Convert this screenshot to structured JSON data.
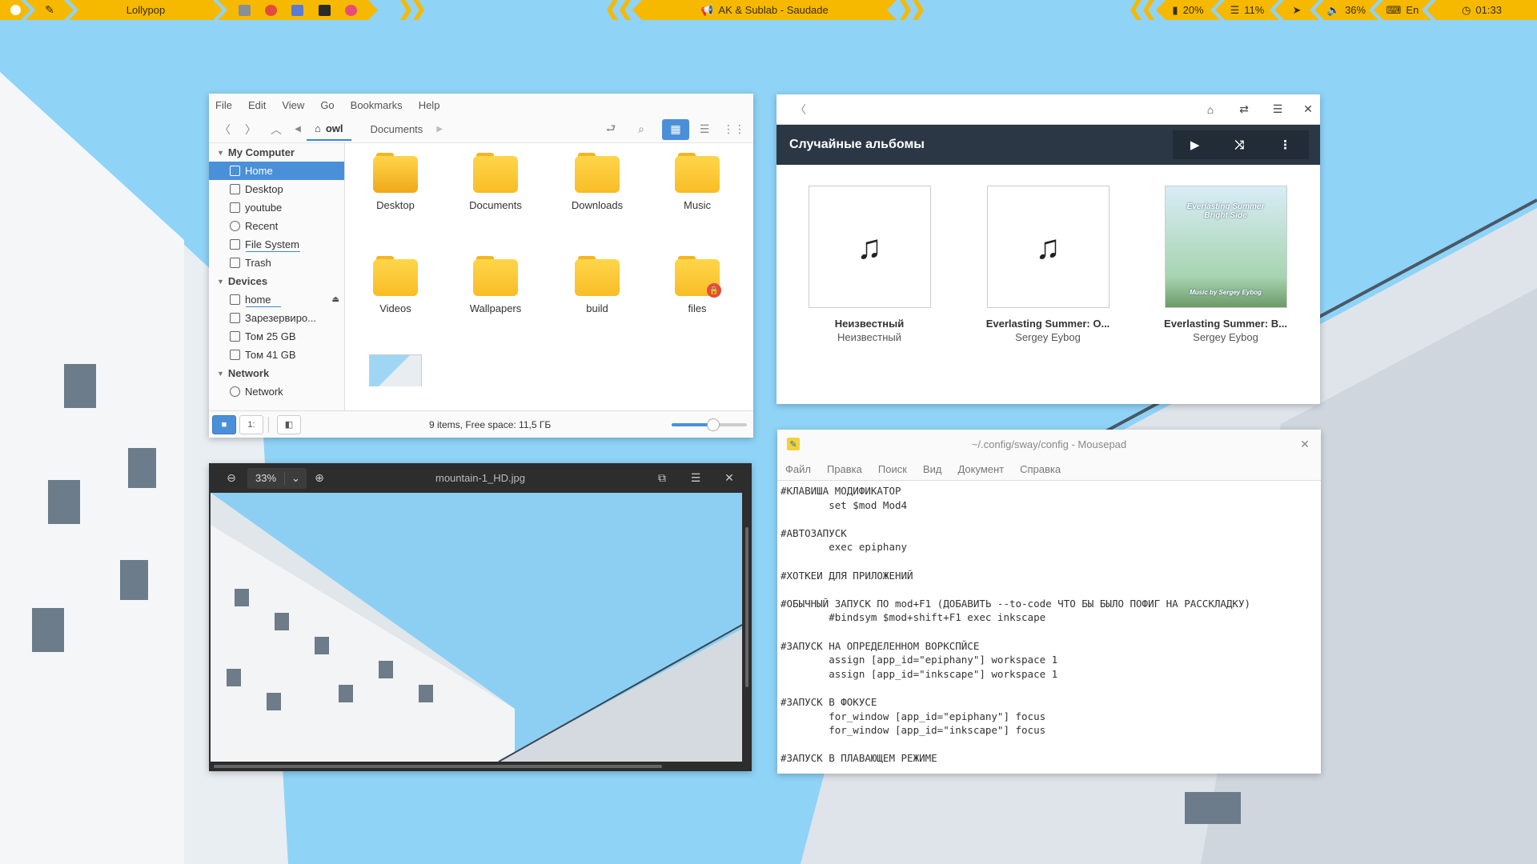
{
  "topbar": {
    "left_app": "Lollypop",
    "now_playing": "AK & Sublab - Saudade",
    "status": {
      "battery": "20%",
      "brightness": "11%",
      "volume": "36%",
      "layout": "En",
      "clock": "01:33"
    },
    "accent": "#f6b900"
  },
  "file_manager": {
    "menu": [
      "File",
      "Edit",
      "View",
      "Go",
      "Bookmarks",
      "Help"
    ],
    "breadcrumb": [
      "owl",
      "Documents"
    ],
    "sidebar": {
      "my_computer": "My Computer",
      "places": [
        {
          "label": "Home",
          "icon": "home-icon",
          "selected": true
        },
        {
          "label": "Desktop",
          "icon": "desktop-icon"
        },
        {
          "label": "youtube",
          "icon": "folder-icon"
        },
        {
          "label": "Recent",
          "icon": "clock-icon"
        },
        {
          "label": "File System",
          "icon": "drive-icon"
        },
        {
          "label": "Trash",
          "icon": "trash-icon"
        }
      ],
      "devices": "Devices",
      "device_items": [
        {
          "label": "home",
          "icon": "drive-icon"
        },
        {
          "label": "Зарезервиро...",
          "icon": "drive-icon"
        },
        {
          "label": "Том 25 GB",
          "icon": "drive-icon"
        },
        {
          "label": "Том 41 GB",
          "icon": "drive-icon"
        }
      ],
      "network": "Network",
      "network_items": [
        {
          "label": "Network",
          "icon": "globe-icon"
        }
      ]
    },
    "items": [
      "Desktop",
      "Documents",
      "Downloads",
      "Music",
      "Videos",
      "Wallpapers",
      "build",
      "files"
    ],
    "status": "9 items, Free space: 11,5 ГБ",
    "zoom_level": 0.55
  },
  "music": {
    "section_title": "Случайные альбомы",
    "albums": [
      {
        "title": "Неизвестный",
        "artist": "Неизвестный"
      },
      {
        "title": "Everlasting Summer: O...",
        "artist": "Sergey Eybog"
      },
      {
        "title": "Everlasting Summer: B...",
        "artist": "Sergey Eybog",
        "cover_line1": "Everlasting Summer",
        "cover_line2": "Bright Side",
        "cover_footer": "Music by Sergey Eybog"
      }
    ]
  },
  "image_viewer": {
    "zoom": "33%",
    "filename": "mountain-1_HD.jpg"
  },
  "editor": {
    "title": "~/.config/sway/config - Mousepad",
    "menu": [
      "Файл",
      "Правка",
      "Поиск",
      "Вид",
      "Документ",
      "Справка"
    ],
    "lines": [
      "#КЛАВИША МОДИФИКАТОР",
      "        set $mod Mod4",
      "",
      "#АВТОЗАПУСК",
      "        exec epiphany",
      "",
      "#ХОТКЕИ ДЛЯ ПРИЛОЖЕНИЙ",
      "",
      "#ОБЫЧНЫЙ ЗАПУСК ПО mod+F1 (ДОБАВИТЬ --to-code ЧТО БЫ БЫЛО ПОФИГ НА РАССКЛАДКУ)",
      "        #bindsym $mod+shift+F1 exec inkscape",
      "",
      "#ЗАПУСК НА ОПРЕДЕЛЕННОМ ВОРКСПЙСЕ",
      "        assign [app_id=\"epiphany\"] workspace 1",
      "        assign [app_id=\"inkscape\"] workspace 1",
      "",
      "#ЗАПУСК В ФОКУСЕ",
      "        for_window [app_id=\"epiphany\"] focus",
      "        for_window [app_id=\"inkscape\"] focus",
      "",
      "#ЗАПУСК В ПЛАВАЮЩЕМ РЕЖИМЕ"
    ]
  }
}
